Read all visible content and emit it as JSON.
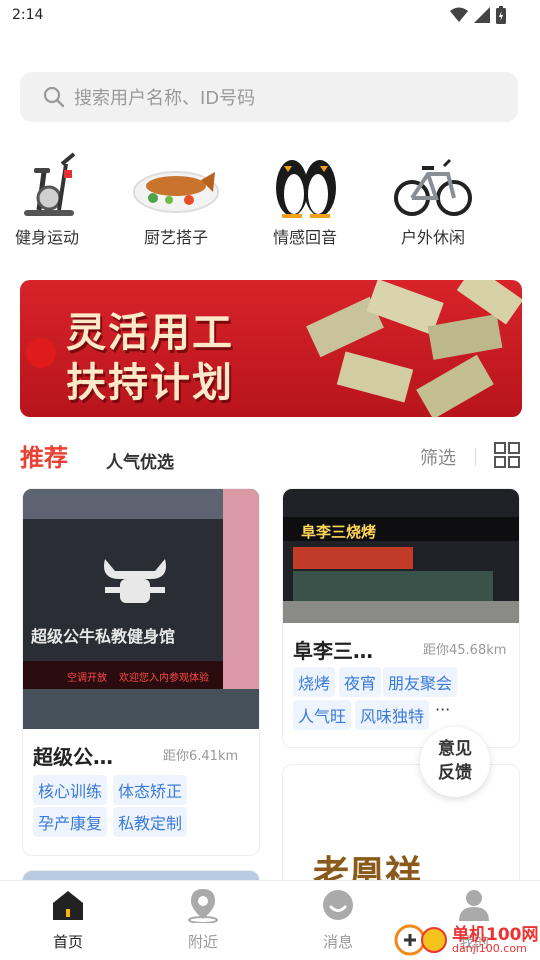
{
  "status_bar": {
    "time": "2:14"
  },
  "search": {
    "placeholder": "搜索用户名称、ID号码"
  },
  "categories": [
    {
      "label": "健身运动",
      "icon": "exercise-bike-icon"
    },
    {
      "label": "厨艺搭子",
      "icon": "grilled-fish-dish-icon"
    },
    {
      "label": "情感回音",
      "icon": "penguins-icon"
    },
    {
      "label": "户外休闲",
      "icon": "bicycle-icon"
    }
  ],
  "banner": {
    "line1": "灵活用工",
    "line2": "扶持计划"
  },
  "tabs": {
    "recommend": "推荐",
    "popular": "人气优选",
    "filter": "筛选"
  },
  "cards": [
    {
      "title": "超级公…",
      "distance": "距你6.41km",
      "sign_text": "超级公牛私教健身馆",
      "sign_sub": "欢迎您入内参观体验",
      "sign_open": "空调开放",
      "tags": [
        "核心训练",
        "体态矫正",
        "孕产康复",
        "私教定制"
      ]
    },
    {
      "title": "阜李三…",
      "distance": "距你45.68km",
      "sign_text": "阜李三烧烤",
      "tags": [
        "烧烤",
        "夜宵",
        "朋友聚会",
        "人气旺",
        "风味独特"
      ],
      "more": "···"
    },
    {
      "sign_text": "老凰祥"
    }
  ],
  "feedback": {
    "line1": "意见",
    "line2": "反馈"
  },
  "nav": [
    {
      "label": "首页",
      "icon": "home-icon",
      "active": true
    },
    {
      "label": "附近",
      "icon": "location-pin-icon",
      "active": false
    },
    {
      "label": "消息",
      "icon": "message-bubble-icon",
      "active": false
    },
    {
      "label": "我的",
      "icon": "user-icon",
      "active": false
    }
  ],
  "watermark": {
    "text": "单机100网",
    "sub": "danji100.com"
  },
  "colors": {
    "accent_red": "#e94235",
    "tag_blue": "#3a7ad9",
    "tag_bg": "#eef4fd"
  }
}
